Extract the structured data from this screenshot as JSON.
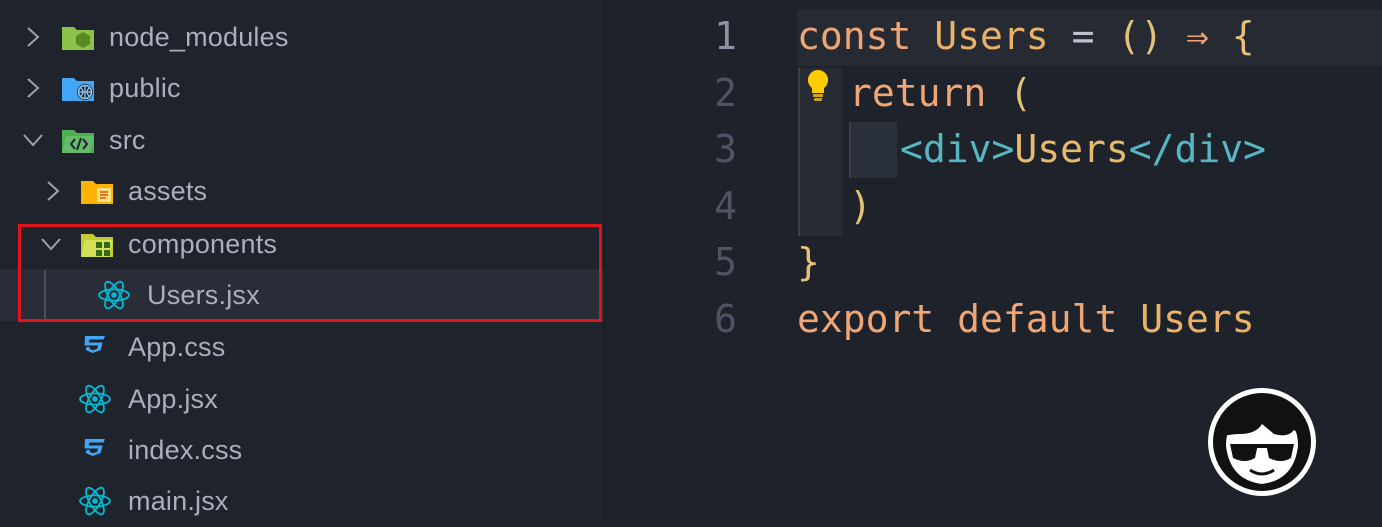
{
  "explorer": {
    "items": [
      {
        "label": "node_modules",
        "chevron": "right",
        "icon": "node-modules-folder-icon",
        "color": "#8bc34a"
      },
      {
        "label": "public",
        "chevron": "right",
        "icon": "public-folder-icon",
        "color": "#42a5f5"
      },
      {
        "label": "src",
        "chevron": "down",
        "icon": "src-folder-icon",
        "color": "#4caf50"
      },
      {
        "label": "assets",
        "chevron": "right",
        "icon": "assets-folder-icon",
        "color": "#ffca28"
      },
      {
        "label": "components",
        "chevron": "down",
        "icon": "components-folder-icon",
        "color": "#c0ca33"
      },
      {
        "label": "Users.jsx",
        "icon": "react-icon",
        "color": "#00bcd4",
        "selected": true
      },
      {
        "label": "App.css",
        "icon": "css-icon",
        "color": "#42a5f5"
      },
      {
        "label": "App.jsx",
        "icon": "react-icon",
        "color": "#00bcd4"
      },
      {
        "label": "index.css",
        "icon": "css-icon",
        "color": "#42a5f5"
      },
      {
        "label": "main.jsx",
        "icon": "react-icon",
        "color": "#00bcd4"
      }
    ],
    "highlight_color": "#e0141c"
  },
  "editor": {
    "line_numbers": [
      "1",
      "2",
      "3",
      "4",
      "5",
      "6"
    ],
    "active_line": "1",
    "tokens": {
      "l1_const": "const",
      "l1_name": "Users",
      "l1_eq": "=",
      "l1_parens": "()",
      "l1_arrow": "⇒",
      "l1_brace": "{",
      "l2_return": "return",
      "l2_paren": "(",
      "l3_open": "<div>",
      "l3_text": "Users",
      "l3_close": "</div>",
      "l4_paren": ")",
      "l5_brace": "}",
      "l6_export": "export",
      "l6_default": "default",
      "l6_name": "Users"
    },
    "lightbulb_icon": "lightbulb-icon"
  },
  "overlay": {
    "mascot": "sunglasses-mascot-icon"
  }
}
